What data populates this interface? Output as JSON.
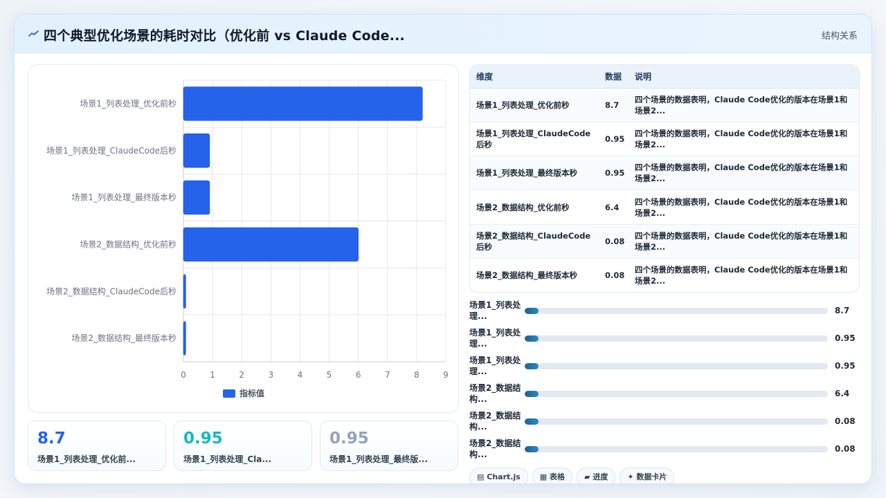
{
  "header": {
    "icon": "trend-line-icon",
    "title": "四个典型优化场景的耗时对比（优化前 vs Claude Code...",
    "right_label": "结构关系"
  },
  "colors": {
    "bar": "#2563eb",
    "stat1": "#2563eb",
    "stat2": "#14b8c8",
    "stat3": "#94a3b8"
  },
  "chart_data": {
    "type": "bar",
    "orientation": "horizontal",
    "categories": [
      "场景1_列表处理_优化前秒",
      "场景1_列表处理_ClaudeCode后秒",
      "场景1_列表处理_最终版本秒",
      "场景2_数据结构_优化前秒",
      "场景2_数据结构_ClaudeCode后秒",
      "场景2_数据结构_最终版本秒"
    ],
    "series": [
      {
        "name": "指标值",
        "values": [
          8.2,
          0.9,
          0.9,
          6.0,
          0.08,
          0.08
        ]
      }
    ],
    "xlim": [
      0,
      9
    ],
    "xticks": [
      "0",
      "1",
      "2",
      "3",
      "4",
      "5",
      "6",
      "7",
      "8",
      "9"
    ],
    "grid": true,
    "legend": "bottom"
  },
  "stats": [
    {
      "value": "8.7",
      "label": "场景1_列表处理_优化前..."
    },
    {
      "value": "0.95",
      "label": "场景1_列表处理_Cla..."
    },
    {
      "value": "0.95",
      "label": "场景1_列表处理_最终版..."
    }
  ],
  "table": {
    "headers": [
      "维度",
      "数据",
      "说明"
    ],
    "rows": [
      {
        "dim": "场景1_列表处理_优化前秒",
        "val": "8.7",
        "desc": "四个场景的数据表明，Claude Code优化的版本在场景1和场景2..."
      },
      {
        "dim": "场景1_列表处理_ClaudeCode后秒",
        "val": "0.95",
        "desc": "四个场景的数据表明，Claude Code优化的版本在场景1和场景2..."
      },
      {
        "dim": "场景1_列表处理_最终版本秒",
        "val": "0.95",
        "desc": "四个场景的数据表明，Claude Code优化的版本在场景1和场景2..."
      },
      {
        "dim": "场景2_数据结构_优化前秒",
        "val": "6.4",
        "desc": "四个场景的数据表明，Claude Code优化的版本在场景1和场景2..."
      },
      {
        "dim": "场景2_数据结构_ClaudeCode后秒",
        "val": "0.08",
        "desc": "四个场景的数据表明，Claude Code优化的版本在场景1和场景2..."
      },
      {
        "dim": "场景2_数据结构_最终版本秒",
        "val": "0.08",
        "desc": "四个场景的数据表明，Claude Code优化的版本在场景1和场景2..."
      }
    ]
  },
  "progress": [
    {
      "label": "场景1_列表处理...",
      "value": "8.7",
      "fraction": 0.02
    },
    {
      "label": "场景1_列表处理...",
      "value": "0.95",
      "fraction": 0.02
    },
    {
      "label": "场景1_列表处理...",
      "value": "0.95",
      "fraction": 0.02
    },
    {
      "label": "场景2_数据结构...",
      "value": "6.4",
      "fraction": 0.02
    },
    {
      "label": "场景2_数据结构...",
      "value": "0.08",
      "fraction": 0.02
    },
    {
      "label": "场景2_数据结构...",
      "value": "0.08",
      "fraction": 0.02
    }
  ],
  "tags": [
    {
      "icon": "chart-icon",
      "glyph": "▤",
      "label": "Chart.js"
    },
    {
      "icon": "table-icon",
      "glyph": "▦",
      "label": "表格"
    },
    {
      "icon": "progress-icon",
      "glyph": "▰",
      "label": "进度"
    },
    {
      "icon": "sparkle-icon",
      "glyph": "✦",
      "label": "数据卡片"
    }
  ]
}
